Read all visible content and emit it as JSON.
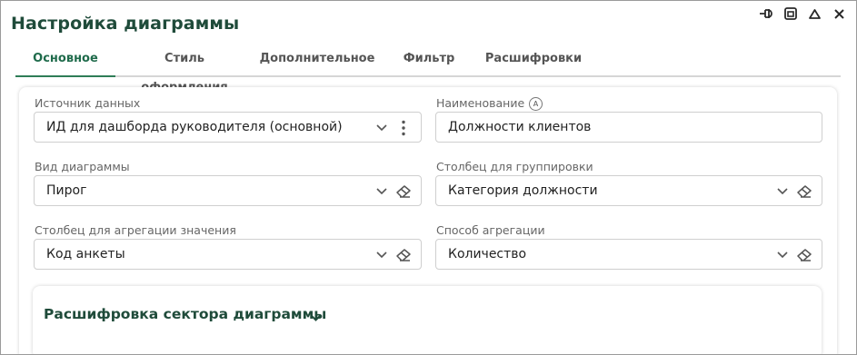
{
  "window": {
    "title": "Настройка диаграммы",
    "controls": [
      "pin-icon",
      "restore-icon",
      "collapse-icon",
      "close-icon"
    ]
  },
  "tabs": [
    {
      "label": "Основное",
      "active": true
    },
    {
      "label": "Стиль оформления",
      "active": false
    },
    {
      "label": "Дополнительное",
      "active": false
    },
    {
      "label": "Фильтр",
      "active": false
    },
    {
      "label": "Расшифровки",
      "active": false
    }
  ],
  "form": {
    "data_source": {
      "label": "Источник данных",
      "value": "ИД для дашборда руководителя (основной)"
    },
    "name": {
      "label": "Наименование",
      "badge": "A",
      "value": "Должности клиентов"
    },
    "chart_type": {
      "label": "Вид диаграммы",
      "value": "Пирог"
    },
    "group_column": {
      "label": "Столбец для группировки",
      "value": "Категория должности"
    },
    "agg_column": {
      "label": "Столбец для агрегации значения",
      "value": "Код анкеты"
    },
    "agg_method": {
      "label": "Способ агрегации",
      "value": "Количество"
    }
  },
  "section": {
    "title": "Расшифровка сектора диаграммы"
  },
  "colors": {
    "accent": "#2e7d57",
    "title": "#1f4b3a"
  }
}
